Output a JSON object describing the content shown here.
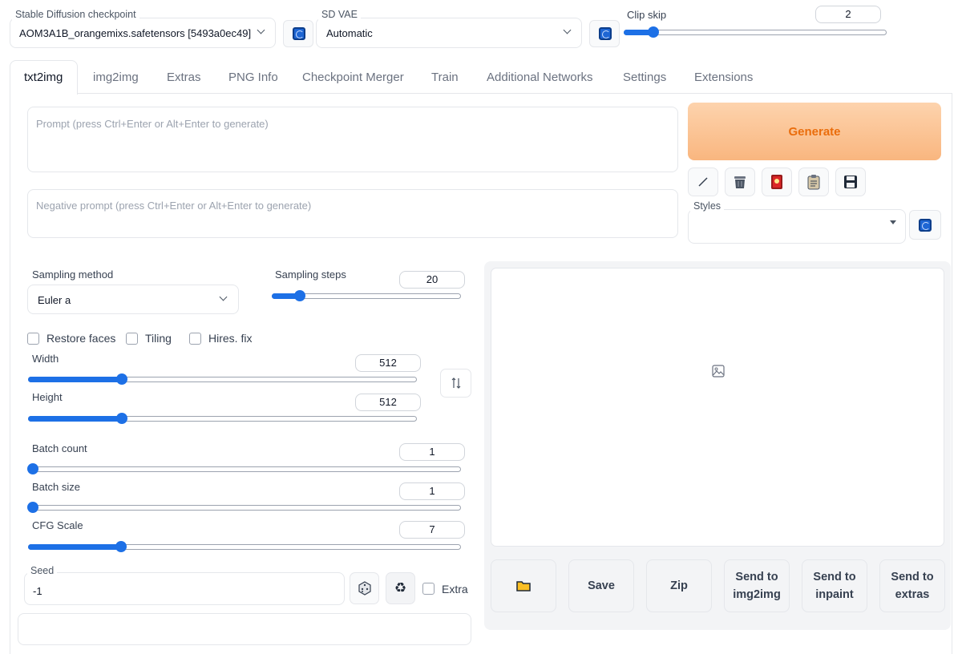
{
  "top": {
    "checkpoint": {
      "label": "Stable Diffusion checkpoint",
      "value": "AOM3A1B_orangemixs.safetensors [5493a0ec49]"
    },
    "vae": {
      "label": "SD VAE",
      "value": "Automatic"
    },
    "clip_skip": {
      "label": "Clip skip",
      "value": "2",
      "fraction": 0.1
    }
  },
  "tabs": [
    "txt2img",
    "img2img",
    "Extras",
    "PNG Info",
    "Checkpoint Merger",
    "Train",
    "Additional Networks",
    "Settings",
    "Extensions"
  ],
  "prompt": {
    "placeholder": "Prompt (press Ctrl+Enter or Alt+Enter to generate)"
  },
  "negative_prompt": {
    "placeholder": "Negative prompt (press Ctrl+Enter or Alt+Enter to generate)"
  },
  "generate_label": "Generate",
  "styles": {
    "label": "Styles"
  },
  "sampling": {
    "method_label": "Sampling method",
    "method_value": "Euler a",
    "steps_label": "Sampling steps",
    "steps_value": "20",
    "steps_fraction": 0.13
  },
  "checkboxes": {
    "restore_faces": "Restore faces",
    "tiling": "Tiling",
    "hires_fix": "Hires. fix"
  },
  "width": {
    "label": "Width",
    "value": "512",
    "fraction": 0.236
  },
  "height": {
    "label": "Height",
    "value": "512",
    "fraction": 0.236
  },
  "batch_count": {
    "label": "Batch count",
    "value": "1",
    "fraction": 0
  },
  "batch_size": {
    "label": "Batch size",
    "value": "1",
    "fraction": 0
  },
  "cfg_scale": {
    "label": "CFG Scale",
    "value": "7",
    "fraction": 0.21
  },
  "seed": {
    "label": "Seed",
    "value": "-1",
    "extra_label": "Extra"
  },
  "actions": {
    "save": "Save",
    "zip": "Zip",
    "send_img2img_1": "Send to",
    "send_img2img_2": "img2img",
    "send_inpaint_1": "Send to",
    "send_inpaint_2": "inpaint",
    "send_extras_1": "Send to",
    "send_extras_2": "extras"
  },
  "colors": {
    "accent": "#1d70e6",
    "generate_bg": "#fbc18d",
    "generate_text": "#ea6d0c"
  }
}
